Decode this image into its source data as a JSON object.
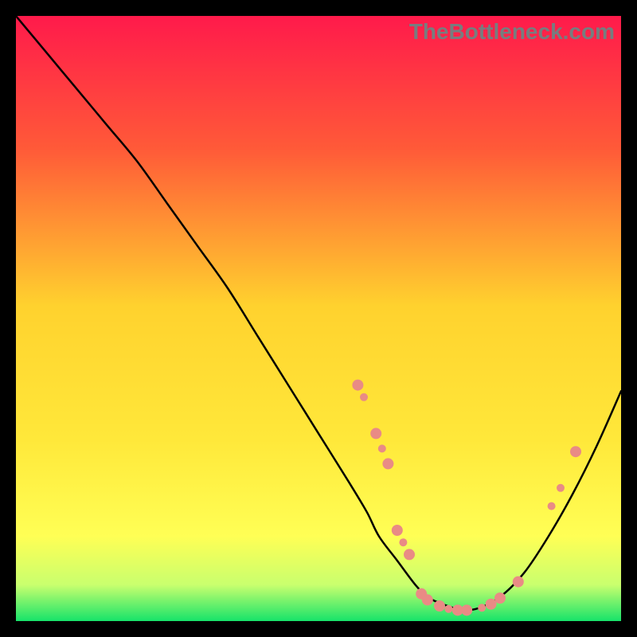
{
  "watermark": "TheBottleneck.com",
  "chart_data": {
    "type": "line",
    "title": "",
    "xlabel": "",
    "ylabel": "",
    "xlim": [
      0,
      100
    ],
    "ylim": [
      0,
      100
    ],
    "grid": false,
    "legend": false,
    "background_gradient": {
      "top": "#ff1a4b",
      "mid1": "#ff6f36",
      "mid2": "#ffd22e",
      "mid3": "#ffff55",
      "mid4": "#c9ff6e",
      "bottom": "#17e36a"
    },
    "series": [
      {
        "name": "bottleneck-curve",
        "stroke": "#000000",
        "x": [
          0,
          5,
          10,
          15,
          20,
          25,
          30,
          35,
          40,
          45,
          50,
          55,
          58,
          60,
          63,
          66,
          68,
          70,
          73,
          76,
          80,
          84,
          88,
          92,
          96,
          100
        ],
        "y": [
          100,
          94,
          88,
          82,
          76,
          69,
          62,
          55,
          47,
          39,
          31,
          23,
          18,
          14,
          10,
          6,
          4,
          3,
          2,
          2,
          4,
          8,
          14,
          21,
          29,
          38
        ]
      }
    ],
    "markers": {
      "name": "highlight-points",
      "color": "#e98b85",
      "radius_small": 5,
      "radius_large": 7,
      "points": [
        {
          "x": 56.5,
          "y": 39,
          "r": 7
        },
        {
          "x": 57.5,
          "y": 37,
          "r": 5
        },
        {
          "x": 59.5,
          "y": 31,
          "r": 7
        },
        {
          "x": 60.5,
          "y": 28.5,
          "r": 5
        },
        {
          "x": 61.5,
          "y": 26,
          "r": 7
        },
        {
          "x": 63.0,
          "y": 15,
          "r": 7
        },
        {
          "x": 64.0,
          "y": 13,
          "r": 5
        },
        {
          "x": 65.0,
          "y": 11,
          "r": 7
        },
        {
          "x": 67.0,
          "y": 4.5,
          "r": 7
        },
        {
          "x": 68.0,
          "y": 3.5,
          "r": 7
        },
        {
          "x": 70.0,
          "y": 2.5,
          "r": 7
        },
        {
          "x": 71.5,
          "y": 2.0,
          "r": 5
        },
        {
          "x": 73.0,
          "y": 1.8,
          "r": 7
        },
        {
          "x": 74.5,
          "y": 1.8,
          "r": 7
        },
        {
          "x": 77.0,
          "y": 2.2,
          "r": 5
        },
        {
          "x": 78.5,
          "y": 2.8,
          "r": 7
        },
        {
          "x": 80.0,
          "y": 3.8,
          "r": 7
        },
        {
          "x": 83.0,
          "y": 6.5,
          "r": 7
        },
        {
          "x": 88.5,
          "y": 19,
          "r": 5
        },
        {
          "x": 90.0,
          "y": 22,
          "r": 5
        },
        {
          "x": 92.5,
          "y": 28,
          "r": 7
        }
      ]
    }
  }
}
